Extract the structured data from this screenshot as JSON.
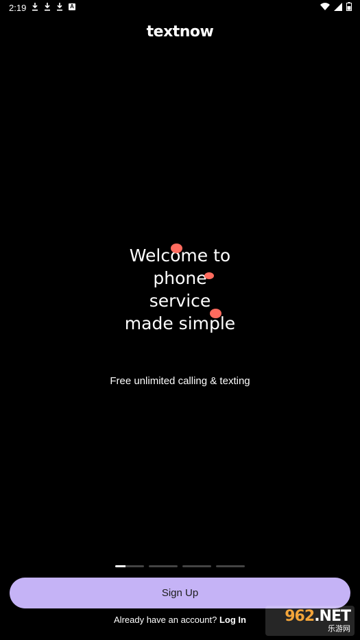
{
  "status_bar": {
    "time": "2:19",
    "notification_icons": [
      "download-icon",
      "download-icon",
      "download-icon",
      "a-icon"
    ],
    "right_icons": [
      "wifi-icon",
      "signal-icon",
      "battery-icon"
    ]
  },
  "logo": "textnow",
  "headline": {
    "lines": [
      "Welcome to",
      "phone",
      "service",
      "made simple"
    ]
  },
  "subtitle": "Free unlimited calling & texting",
  "pager": {
    "count": 4,
    "active_index": 0
  },
  "signup_label": "Sign Up",
  "login": {
    "prompt": "Already have an account?",
    "link": "Log In"
  },
  "watermark": {
    "main": "962",
    "suffix": ".NET",
    "sub": "乐游网"
  },
  "colors": {
    "background": "#000000",
    "accent": "#c5b3f6",
    "bubble": "#ff6b5e"
  }
}
